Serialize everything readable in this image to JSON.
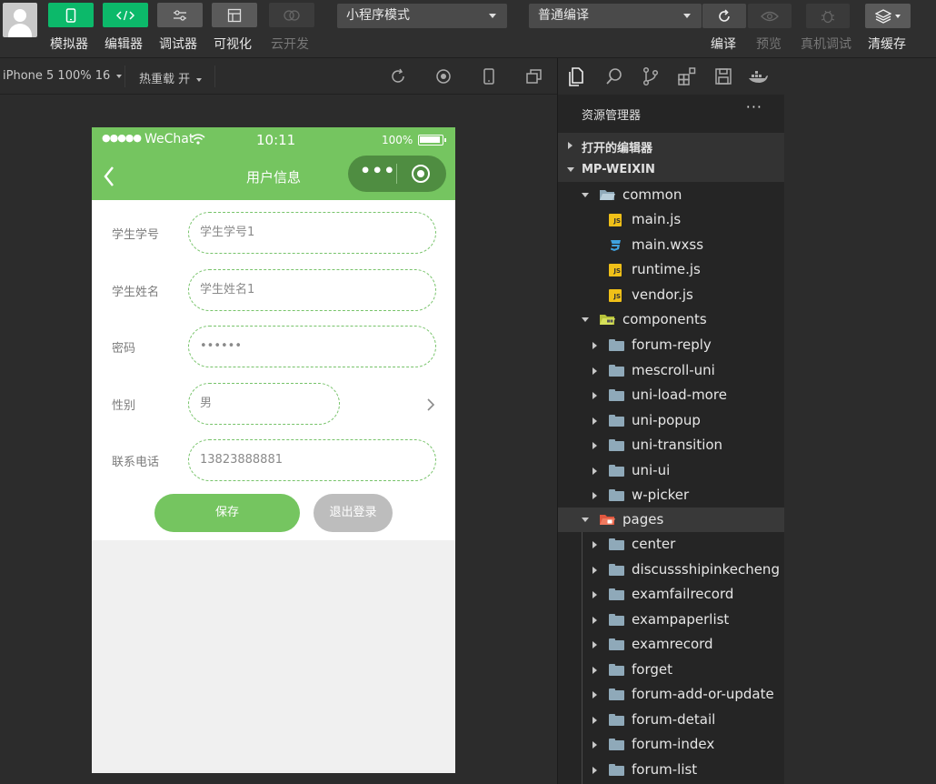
{
  "toolbar": {
    "buttons": [
      {
        "label": "模拟器",
        "icon": "phone-icon"
      },
      {
        "label": "编辑器",
        "icon": "code-icon"
      },
      {
        "label": "调试器",
        "icon": "sliders-icon"
      },
      {
        "label": "可视化",
        "icon": "layout-icon"
      },
      {
        "label": "云开发",
        "icon": "cloud-icon"
      }
    ],
    "mode_select": "小程序模式",
    "compile_select": "普通编译",
    "right_labels": {
      "compile": "编译",
      "preview": "预览",
      "remote_debug": "真机调试",
      "clear_cache": "清缓存"
    }
  },
  "simbar": {
    "device": "iPhone 5 100% 16",
    "hot_reload": "热重载 开"
  },
  "phone": {
    "status_signal": "●●●●●",
    "status_carrier": "WeChat",
    "status_time": "10:11",
    "status_battery": "100%",
    "nav_title": "用户信息",
    "capsule_more": "•••",
    "form": [
      {
        "label": "学生学号",
        "value": "学生学号1"
      },
      {
        "label": "学生姓名",
        "value": "学生姓名1"
      },
      {
        "label": "密码",
        "value": "••••••"
      },
      {
        "label": "性别",
        "value": "男"
      },
      {
        "label": "联系电话",
        "value": "13823888881"
      }
    ],
    "save_button": "保存",
    "logout_button": "退出登录"
  },
  "explorer": {
    "title": "资源管理器",
    "more": "···",
    "open_editors": "打开的编辑器",
    "project": "MP-WEIXIN",
    "common_folder": "common",
    "common_files": [
      "main.js",
      "main.wxss",
      "runtime.js",
      "vendor.js"
    ],
    "components_folder": "components",
    "components": [
      "forum-reply",
      "mescroll-uni",
      "uni-load-more",
      "uni-popup",
      "uni-transition",
      "uni-ui",
      "w-picker"
    ],
    "pages_folder": "pages",
    "pages": [
      "center",
      "discussshipinkecheng",
      "examfailrecord",
      "exampaperlist",
      "examrecord",
      "forget",
      "forum-add-or-update",
      "forum-detail",
      "forum-index",
      "forum-list"
    ]
  },
  "colors": {
    "accent_green": "#0cb96a",
    "mini_program_green": "#75c560",
    "js_icon": "#f0c018",
    "css_icon": "#3fa2e0",
    "folder": "#8fa9b9"
  }
}
